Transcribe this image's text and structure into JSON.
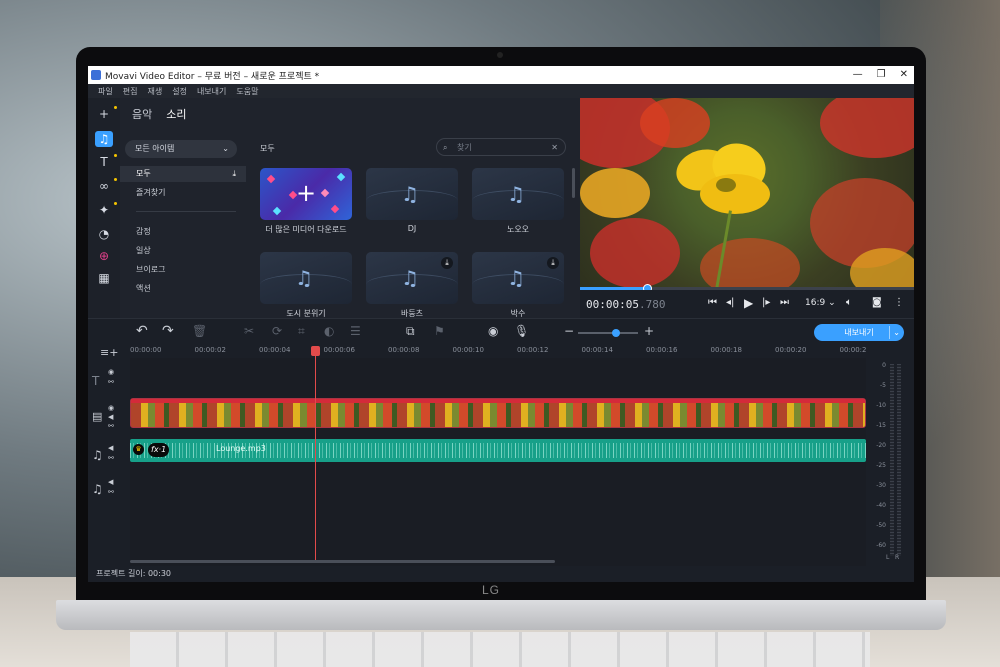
{
  "window": {
    "title": "Movavi Video Editor – 무료 버전 – 새로운 프로젝트 *"
  },
  "menu": [
    "파일",
    "편집",
    "재생",
    "설정",
    "내보내기",
    "도움말"
  ],
  "device": {
    "brand": "LG"
  },
  "library": {
    "tabs": [
      "음악",
      "소리"
    ],
    "category_select": "모든 아이템",
    "categories_top": [
      "모두",
      "즐겨찾기"
    ],
    "categories": [
      "감정",
      "일상",
      "브이로그",
      "액션"
    ],
    "section_title": "모두",
    "search_placeholder": "찾기",
    "tiles": [
      {
        "label": "더 많은 미디어 다운로드",
        "kind": "more"
      },
      {
        "label": "DJ",
        "kind": "sound"
      },
      {
        "label": "노오오",
        "kind": "sound"
      },
      {
        "label": "도시 분위기",
        "kind": "sound"
      },
      {
        "label": "바둥츠",
        "kind": "sound",
        "download": true
      },
      {
        "label": "박수",
        "kind": "sound",
        "download": true
      }
    ]
  },
  "player": {
    "timecode_main": "00:00:05",
    "timecode_ms": ".780",
    "aspect": "16:9",
    "progress": 0.2
  },
  "toolbar": {
    "export_label": "내보내기"
  },
  "ruler": [
    "00:00:00",
    "00:00:02",
    "00:00:04",
    "00:00:06",
    "00:00:08",
    "00:00:10",
    "00:00:12",
    "00:00:14",
    "00:00:16",
    "00:00:18",
    "00:00:20",
    "00:00:2"
  ],
  "audio_clip": {
    "name": "Lounge.mp3",
    "fx": "fx·1"
  },
  "vu_scale": [
    "0",
    "-5",
    "-10",
    "-15",
    "-20",
    "-25",
    "-30",
    "-40",
    "-50",
    "-60"
  ],
  "vu_channels": [
    "L",
    "R"
  ],
  "status": {
    "project_length": "프로젝트 길이: 00:30"
  },
  "colors": {
    "accent": "#3aa0ff",
    "audio": "#17a089",
    "playhead": "#e24b4b"
  }
}
